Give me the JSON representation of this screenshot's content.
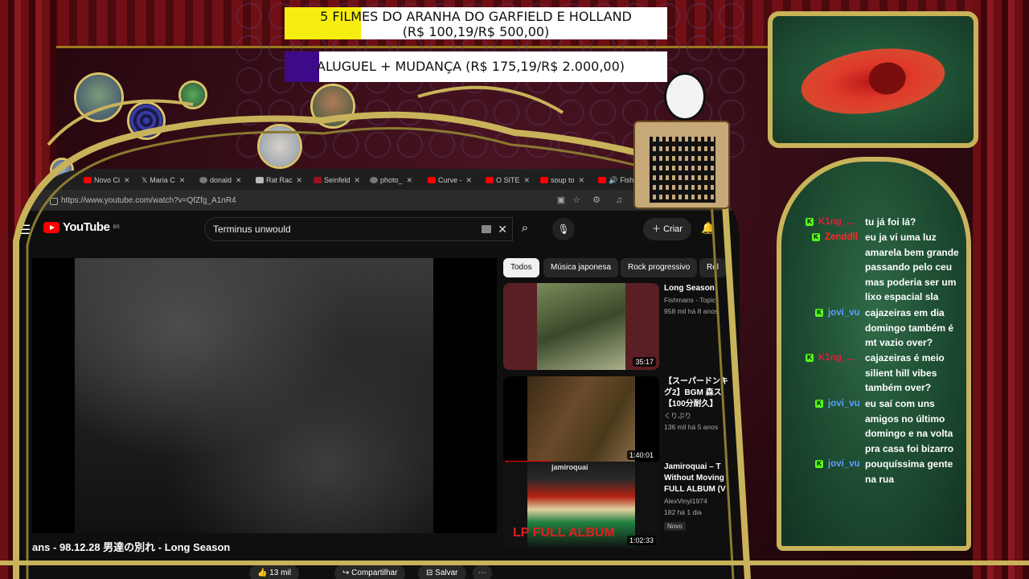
{
  "overlay": {
    "goals": [
      {
        "line1": "5 FILMES DO ARANHA DO GARFIELD E HOLLAND",
        "line2": "(R$ 100,19/R$ 500,00)",
        "progress": 0.2,
        "fill_color": "#f5ee10"
      },
      {
        "text": "ALUGUEL + MUDANÇA (R$ 175,19/R$ 2.000,00)",
        "progress": 0.09,
        "fill_color": "#3d0a8a"
      }
    ]
  },
  "browser": {
    "tabs": [
      {
        "label": "Novo Ci",
        "icon": "youtube-icon"
      },
      {
        "label": "Maria C",
        "icon": "x-icon"
      },
      {
        "label": "donald",
        "icon": "globe-icon"
      },
      {
        "label": "Rat Rac",
        "icon": "wikipedia-icon"
      },
      {
        "label": "Seinfeld",
        "icon": "red-icon"
      },
      {
        "label": "photo_",
        "icon": "globe-icon"
      },
      {
        "label": "Curve -",
        "icon": "youtube-icon"
      },
      {
        "label": "O SITE",
        "icon": "youtube-icon"
      },
      {
        "label": "soup to",
        "icon": "youtube-icon"
      },
      {
        "label": "Fish",
        "icon": "speaker-icon"
      }
    ],
    "url": "https://www.youtube.com/watch?v=QfZfg_A1nR4"
  },
  "youtube": {
    "logo_text": "YouTube",
    "region": "BR",
    "search_value": "Terminus unwould",
    "create_label": "Criar",
    "video_title": "ans - 98.12.28 男達の別れ - Long Season",
    "actions": {
      "likes": "13 mil",
      "share": "Compartilhar",
      "save": "Salvar"
    },
    "chips": [
      "Todos",
      "Música japonesa",
      "Rock progressivo",
      "Rel"
    ],
    "recommendations": [
      {
        "title": "Long Season",
        "channel": "Fishmans - Topic",
        "views": "958 mil",
        "age": "há 8 anos",
        "duration": "35:17"
      },
      {
        "title": "【スーパードンキ",
        "title2": "グ2】BGM 森ス",
        "title3": "【100分耐久】",
        "channel": "くりぷり",
        "views": "136 mil",
        "age": "há 5 anos",
        "duration": "1:40:01"
      },
      {
        "title": "Jamiroquai – T",
        "title2": "Without Moving",
        "title3": "FULL ALBUM (V",
        "channel": "AlexVinyl1974",
        "views": "182",
        "age": "há 1 dia",
        "badge": "Novo",
        "duration": "1:02:33",
        "thumb_text": "LP FULL ALBUM",
        "thumb_brand": "jamiroquai"
      }
    ]
  },
  "chat": {
    "messages": [
      {
        "user": "K1ng_...",
        "user_color": "#e0203a",
        "text": "tu já foi lá?"
      },
      {
        "user": "Zenddll",
        "user_color": "#ff2a2a",
        "text": "eu ja vi uma luz amarela bem grande passando pelo ceu mas poderia ser um lixo espacial sla"
      },
      {
        "user": "jovi_vu",
        "user_color": "#5aa0ff",
        "text": "cajazeiras em dia domingo também é mt vazio over?"
      },
      {
        "user": "K1ng_...",
        "user_color": "#e0203a",
        "text": "cajazeiras é meio silient hill vibes também over?"
      },
      {
        "user": "jovi_vu",
        "user_color": "#5aa0ff",
        "text": "eu saí com uns amigos no último domingo e na volta pra casa foi bizarro"
      },
      {
        "user": "jovi_vu",
        "user_color": "#5aa0ff",
        "text": "pouquíssima gente na rua"
      }
    ]
  }
}
